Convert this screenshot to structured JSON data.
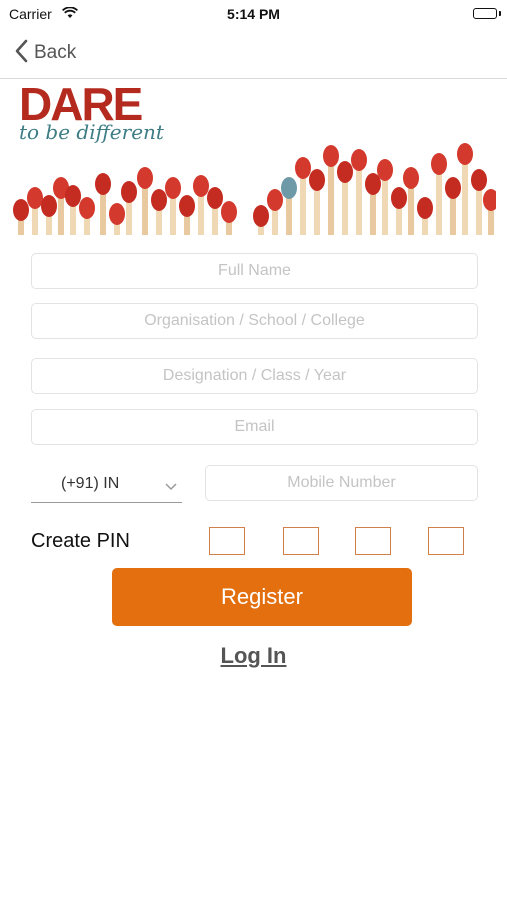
{
  "status_bar": {
    "carrier": "Carrier",
    "time": "5:14 PM"
  },
  "nav": {
    "back_label": "Back"
  },
  "banner": {
    "title": "DARE",
    "tagline": "to be different"
  },
  "form": {
    "full_name_placeholder": "Full Name",
    "organisation_placeholder": "Organisation / School / College",
    "designation_placeholder": "Designation / Class / Year",
    "email_placeholder": "Email",
    "country_code": "(+91) IN",
    "mobile_placeholder": "Mobile Number",
    "pin_label": "Create PIN",
    "register_label": "Register",
    "login_label": "Log In"
  },
  "colors": {
    "accent": "#e36f0f",
    "brand_red": "#b52a1f",
    "brand_teal": "#3e7d86",
    "pin_border": "#d1804a"
  }
}
